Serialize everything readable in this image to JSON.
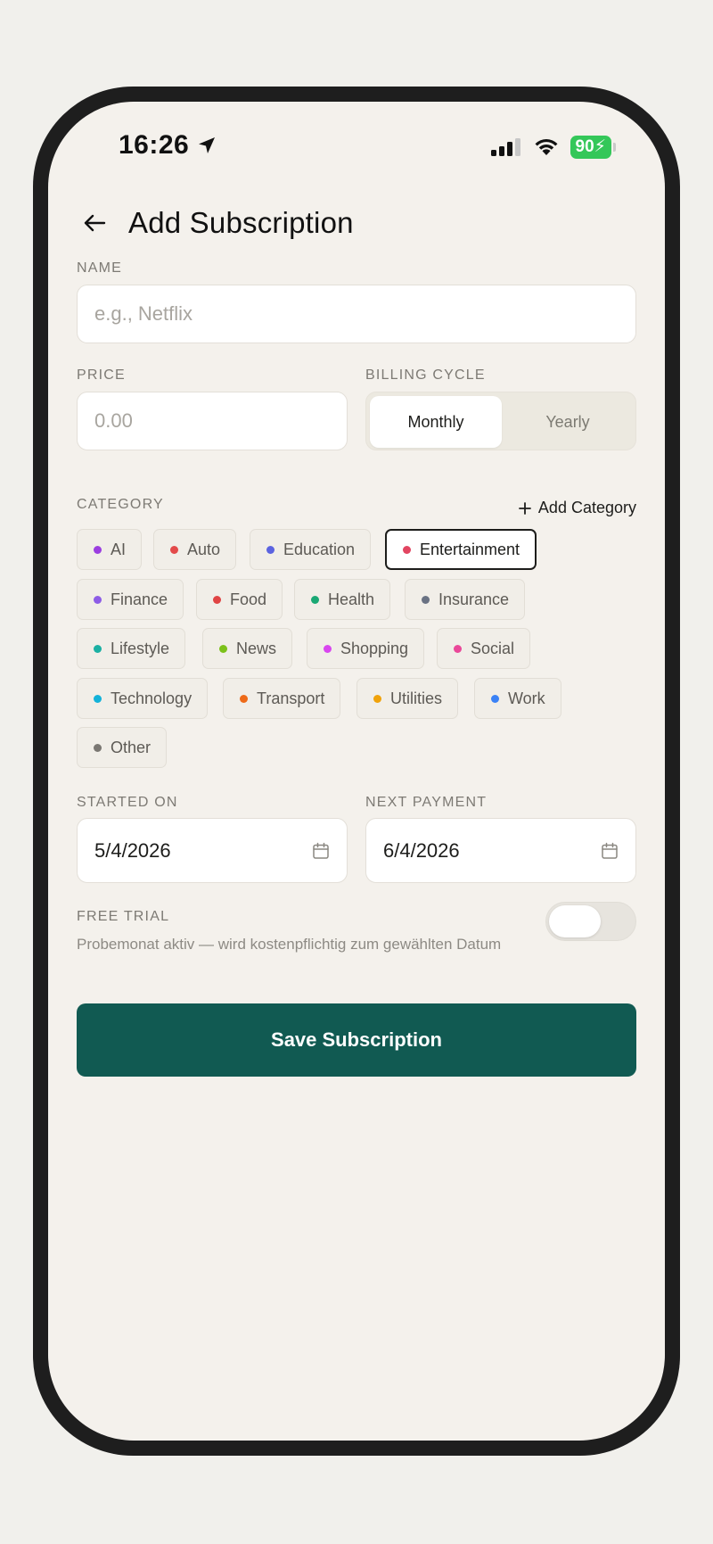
{
  "status": {
    "time": "16:26",
    "battery": "90"
  },
  "header": {
    "title": "Add Subscription"
  },
  "name": {
    "label": "NAME",
    "placeholder": "e.g., Netflix"
  },
  "price": {
    "label": "PRICE",
    "placeholder": "0.00"
  },
  "billing": {
    "label": "BILLING CYCLE",
    "options": [
      "Monthly",
      "Yearly"
    ],
    "selected": "Monthly"
  },
  "category": {
    "label": "CATEGORY",
    "add_label": "Add Category",
    "selected": "Entertainment",
    "items": [
      {
        "name": "AI",
        "color": "#9b3ee0"
      },
      {
        "name": "Auto",
        "color": "#e34a4a"
      },
      {
        "name": "Education",
        "color": "#5b63e0"
      },
      {
        "name": "Entertainment",
        "color": "#e24561"
      },
      {
        "name": "Finance",
        "color": "#8d5ce6"
      },
      {
        "name": "Food",
        "color": "#e04444"
      },
      {
        "name": "Health",
        "color": "#1aa874"
      },
      {
        "name": "Insurance",
        "color": "#6a7283"
      },
      {
        "name": "Lifestyle",
        "color": "#1bb0a3"
      },
      {
        "name": "News",
        "color": "#7cc11a"
      },
      {
        "name": "Shopping",
        "color": "#d946ef"
      },
      {
        "name": "Social",
        "color": "#ea4899"
      },
      {
        "name": "Technology",
        "color": "#13b2d9"
      },
      {
        "name": "Transport",
        "color": "#ee6a18"
      },
      {
        "name": "Utilities",
        "color": "#f0a20a"
      },
      {
        "name": "Work",
        "color": "#3b82f6"
      },
      {
        "name": "Other",
        "color": "#7a7772"
      }
    ]
  },
  "started_on": {
    "label": "STARTED ON",
    "value": "5/4/2026"
  },
  "next_payment": {
    "label": "NEXT PAYMENT",
    "value": "6/4/2026"
  },
  "free_trial": {
    "label": "FREE TRIAL",
    "description": "Probemonat aktiv — wird kostenpflichtig zum gewählten Datum",
    "enabled": false
  },
  "save_button": {
    "label": "Save Subscription"
  },
  "colors": {
    "primary": "#115a52",
    "background": "#f4f1ec"
  }
}
